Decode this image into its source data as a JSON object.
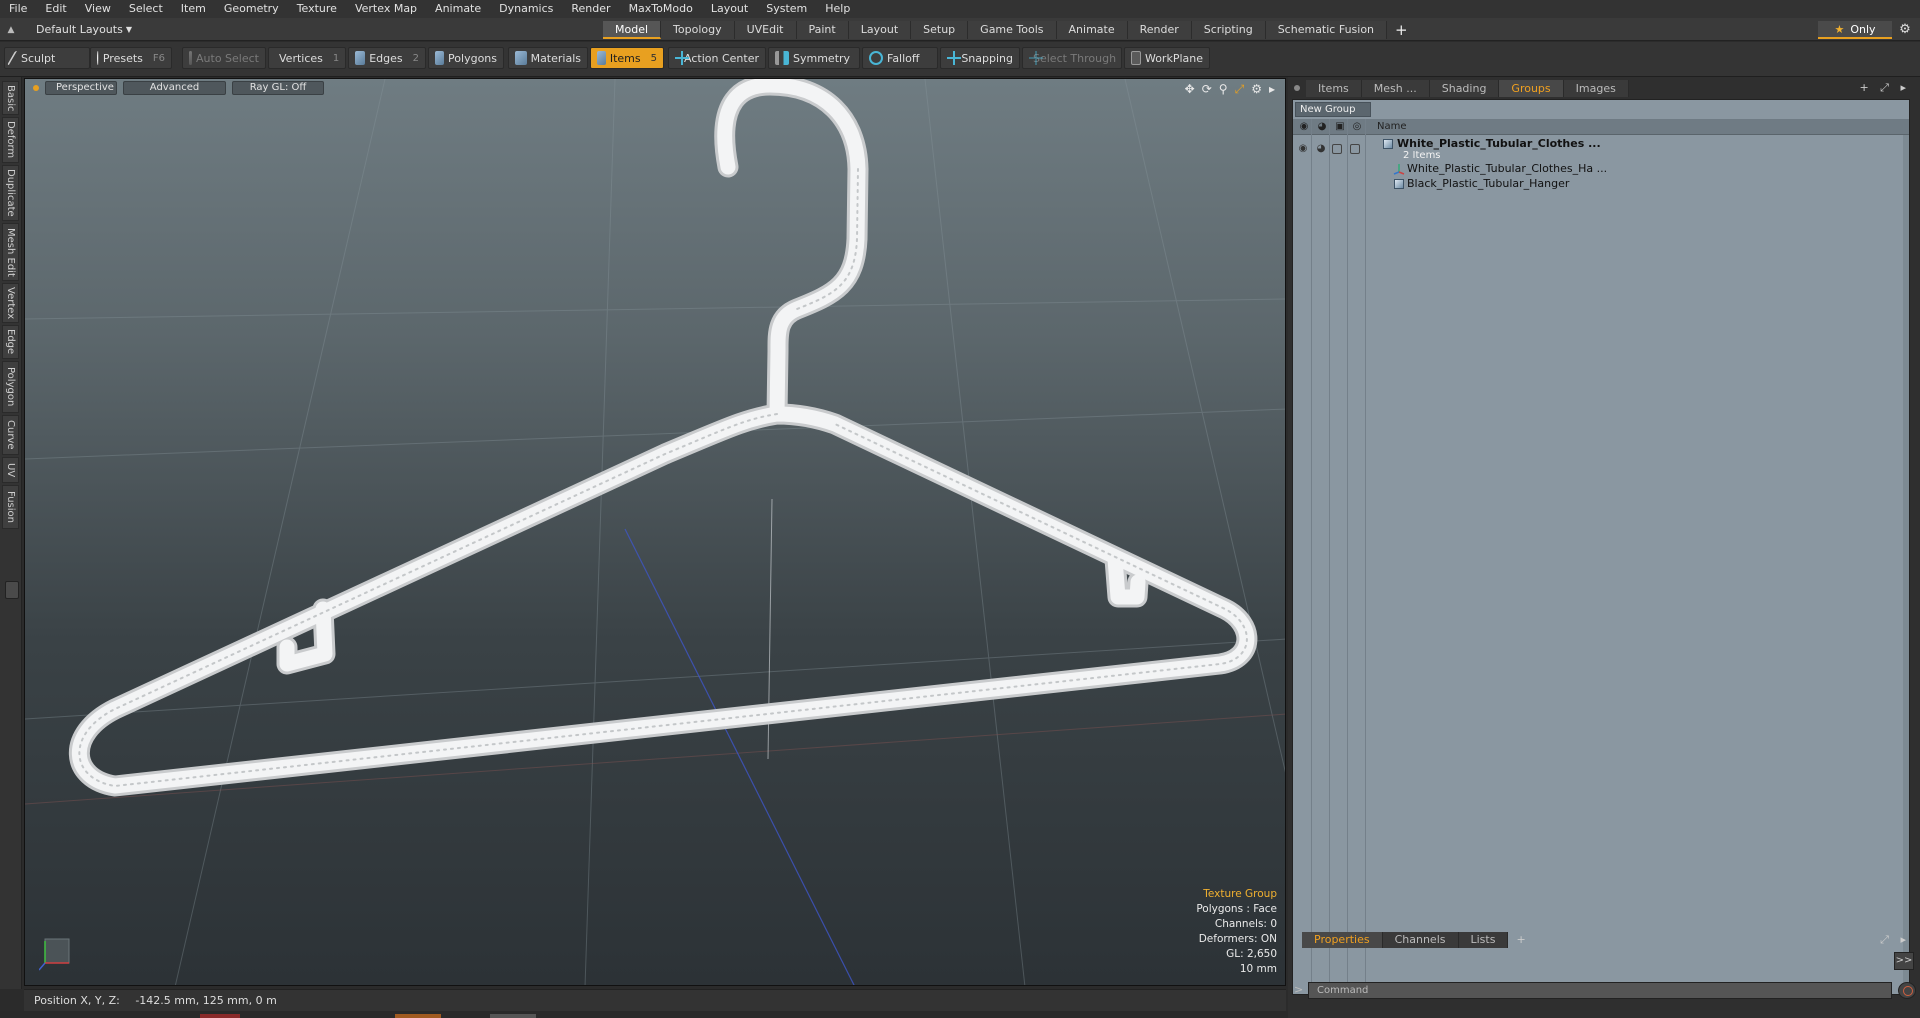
{
  "menubar": {
    "items": [
      "File",
      "Edit",
      "View",
      "Select",
      "Item",
      "Geometry",
      "Texture",
      "Vertex Map",
      "Animate",
      "Dynamics",
      "Render",
      "MaxToModo",
      "Layout",
      "System",
      "Help"
    ]
  },
  "layoutbar": {
    "layout_name": "Default Layouts",
    "tabs": [
      "Model",
      "Topology",
      "UVEdit",
      "Paint",
      "Layout",
      "Setup",
      "Game Tools",
      "Animate",
      "Render",
      "Scripting",
      "Schematic Fusion"
    ],
    "active_tab": "Model",
    "add_tab_label": "+",
    "only_label": "Only"
  },
  "toolbar": {
    "sculpt": "Sculpt",
    "presets": "Presets",
    "presets_key": "F6",
    "auto_select": "Auto Select",
    "vertices": "Vertices",
    "vertices_key": "1",
    "edges": "Edges",
    "edges_key": "2",
    "polygons": "Polygons",
    "materials": "Materials",
    "items": "Items",
    "items_key": "5",
    "action_center": "Action Center",
    "symmetry": "Symmetry",
    "falloff": "Falloff",
    "snapping": "Snapping",
    "select_through": "Select Through",
    "workplane": "WorkPlane"
  },
  "left_tabs": [
    "Basic",
    "Deform",
    "Duplicate",
    "Mesh Edit",
    "Vertex",
    "Edge",
    "Polygon",
    "Curve",
    "UV",
    "Fusion"
  ],
  "viewport": {
    "view_mode": "Perspective",
    "advanced": "Advanced",
    "raygl": "Ray GL: Off",
    "info": {
      "texture_group": "Texture Group",
      "polygons": "Polygons : Face",
      "channels": "Channels: 0",
      "deformers": "Deformers: ON",
      "gl": "GL: 2,650",
      "scale": "10 mm"
    }
  },
  "statusbar": {
    "label": "Position X, Y, Z:",
    "value": "-142.5 mm, 125 mm, 0 m"
  },
  "panel": {
    "tabs": [
      "Items",
      "Mesh ...",
      "Shading",
      "Groups",
      "Images"
    ],
    "active_tab": "Groups",
    "new_group": "New Group",
    "name_header": "Name",
    "group": {
      "name": "White_Plastic_Tubular_Clothes ...",
      "count": "2 Items",
      "children": [
        "White_Plastic_Tubular_Clothes_Ha ...",
        "Black_Plastic_Tubular_Hanger"
      ]
    }
  },
  "bottom_panel": {
    "tabs": [
      "Properties",
      "Channels",
      "Lists"
    ],
    "active_tab": "Properties",
    "add_label": "+",
    "expand": ">>",
    "command_placeholder": "Command",
    "prompt": ">"
  },
  "colors": {
    "accent": "#e8a020",
    "panel_bg": "#8a97a1",
    "viewport_top": "#6f7c82",
    "viewport_bottom": "#2c3236"
  }
}
